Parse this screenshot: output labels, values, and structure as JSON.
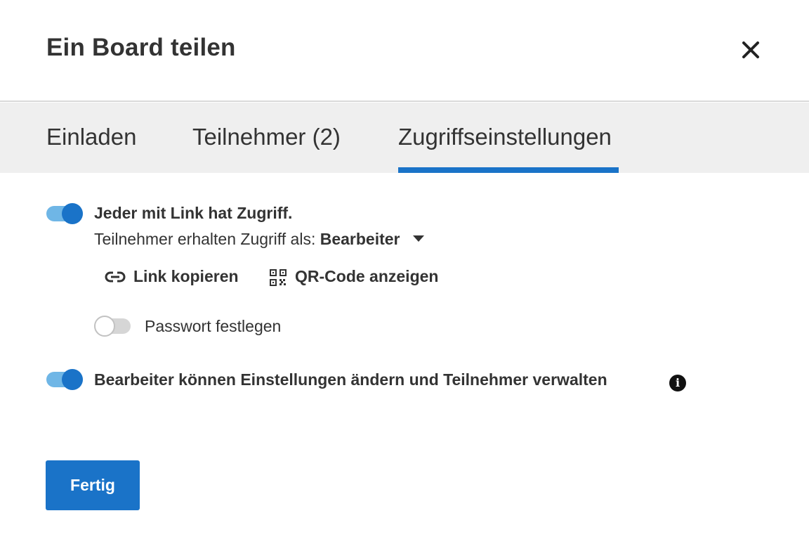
{
  "dialog": {
    "title": "Ein Board teilen",
    "close_icon": "close-icon"
  },
  "tabs": [
    {
      "label": "Einladen",
      "active": false
    },
    {
      "label": "Teilnehmer (2)",
      "active": false
    },
    {
      "label": "Zugriffseinstellungen",
      "active": true
    }
  ],
  "settings": {
    "link_access": {
      "enabled": true,
      "label": "Jeder mit Link hat Zugriff.",
      "role_prefix": "Teilnehmer erhalten Zugriff als:",
      "role_value": "Bearbeiter"
    },
    "actions": {
      "copy_link": {
        "label": "Link kopieren",
        "icon": "link-icon"
      },
      "qr_code": {
        "label": "QR-Code anzeigen",
        "icon": "qr-code-icon"
      }
    },
    "password": {
      "enabled": false,
      "label": "Passwort festlegen"
    },
    "editors_manage": {
      "enabled": true,
      "label": "Bearbeiter können Einstellungen ändern und Teilnehmer verwalten",
      "info_icon": "info-icon"
    }
  },
  "footer": {
    "done_label": "Fertig"
  },
  "colors": {
    "accent": "#1a73c8",
    "toggle_track_on": "#6fb6e6",
    "tabbar_bg": "#efefef"
  }
}
